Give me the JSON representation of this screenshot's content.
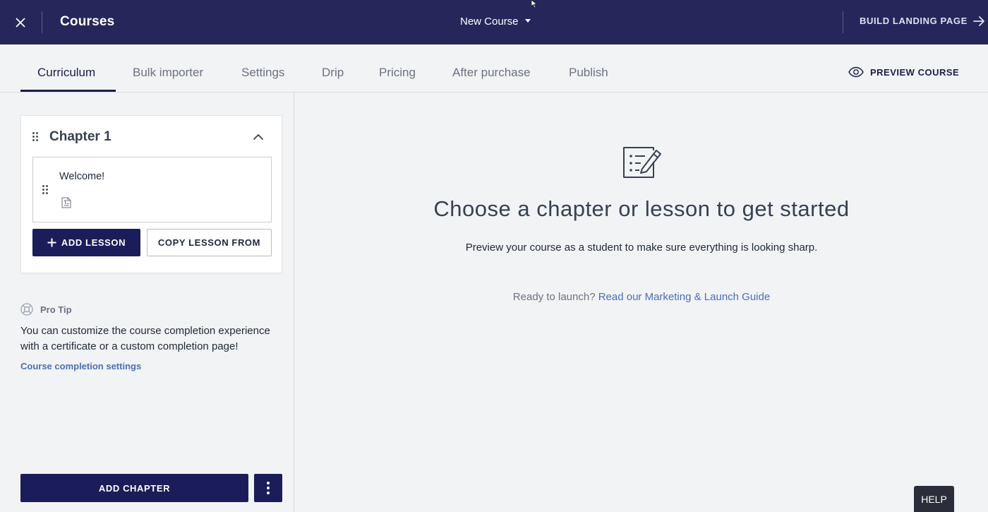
{
  "header": {
    "title": "Courses",
    "course_name": "New Course",
    "build_landing_label": "BUILD LANDING PAGE"
  },
  "tabs": [
    {
      "label": "Curriculum",
      "active": true
    },
    {
      "label": "Bulk importer"
    },
    {
      "label": "Settings"
    },
    {
      "label": "Drip"
    },
    {
      "label": "Pricing"
    },
    {
      "label": "After purchase"
    },
    {
      "label": "Publish"
    }
  ],
  "preview_label": "PREVIEW COURSE",
  "chapter": {
    "title": "Chapter 1",
    "lessons": [
      {
        "title": "Welcome!",
        "type_icon": "text-document-icon"
      }
    ],
    "add_lesson_label": "ADD LESSON",
    "copy_lesson_label": "COPY LESSON FROM"
  },
  "protip": {
    "heading": "Pro Tip",
    "text": "You can customize the course completion experience with a certificate or a custom completion page!",
    "link": "Course completion settings"
  },
  "add_chapter_label": "ADD CHAPTER",
  "main": {
    "heading": "Choose a chapter or lesson to get started",
    "subtext": "Preview your course as a student to make sure everything is looking sharp.",
    "launch_prefix": "Ready to launch?",
    "launch_link": "Read our Marketing & Launch Guide"
  },
  "help_label": "HELP",
  "colors": {
    "header_bg": "#25275a",
    "primary": "#1b1d5a",
    "link": "#4a6fb8"
  }
}
